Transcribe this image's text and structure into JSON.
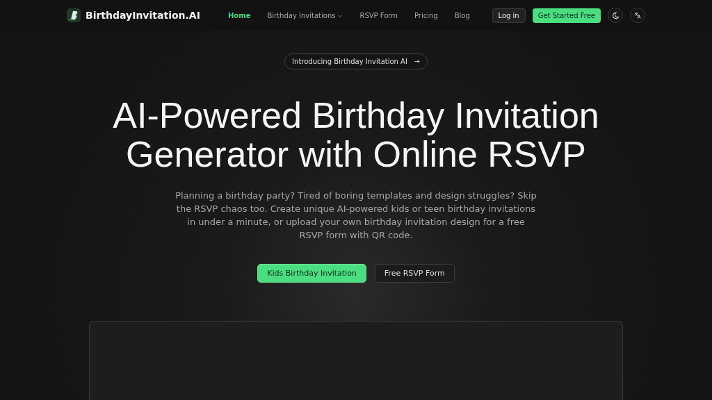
{
  "header": {
    "logo_text": "BirthdayInvitation.AI",
    "nav": [
      {
        "label": "Home",
        "selected": true,
        "kind": "link"
      },
      {
        "label": "Birthday Invitations",
        "selected": false,
        "kind": "dropdown"
      },
      {
        "label": "RSVP Form",
        "selected": false,
        "kind": "link"
      },
      {
        "label": "Pricing",
        "selected": false,
        "kind": "link"
      },
      {
        "label": "Blog",
        "selected": false,
        "kind": "link"
      }
    ],
    "login": "Log in",
    "cta": "Get Started Free"
  },
  "hero": {
    "badge": "Introducing Birthday Invitation AI",
    "title_lines": [
      "AI-Powered Birthday Invitation",
      "Generator with Online RSVP"
    ],
    "description": "Planning a birthday party? Tired of boring templates and design struggles? Skip the RSVP chaos too. Create unique AI-powered kids or teen birthday invitations in under a minute, or upload your own birthday invitation design for a free RSVP form with QR code.",
    "buttons": [
      {
        "label": "Kids Birthday Invitation",
        "kind": "primary"
      },
      {
        "label": "Free RSVP Form",
        "kind": "secondary"
      }
    ]
  }
}
